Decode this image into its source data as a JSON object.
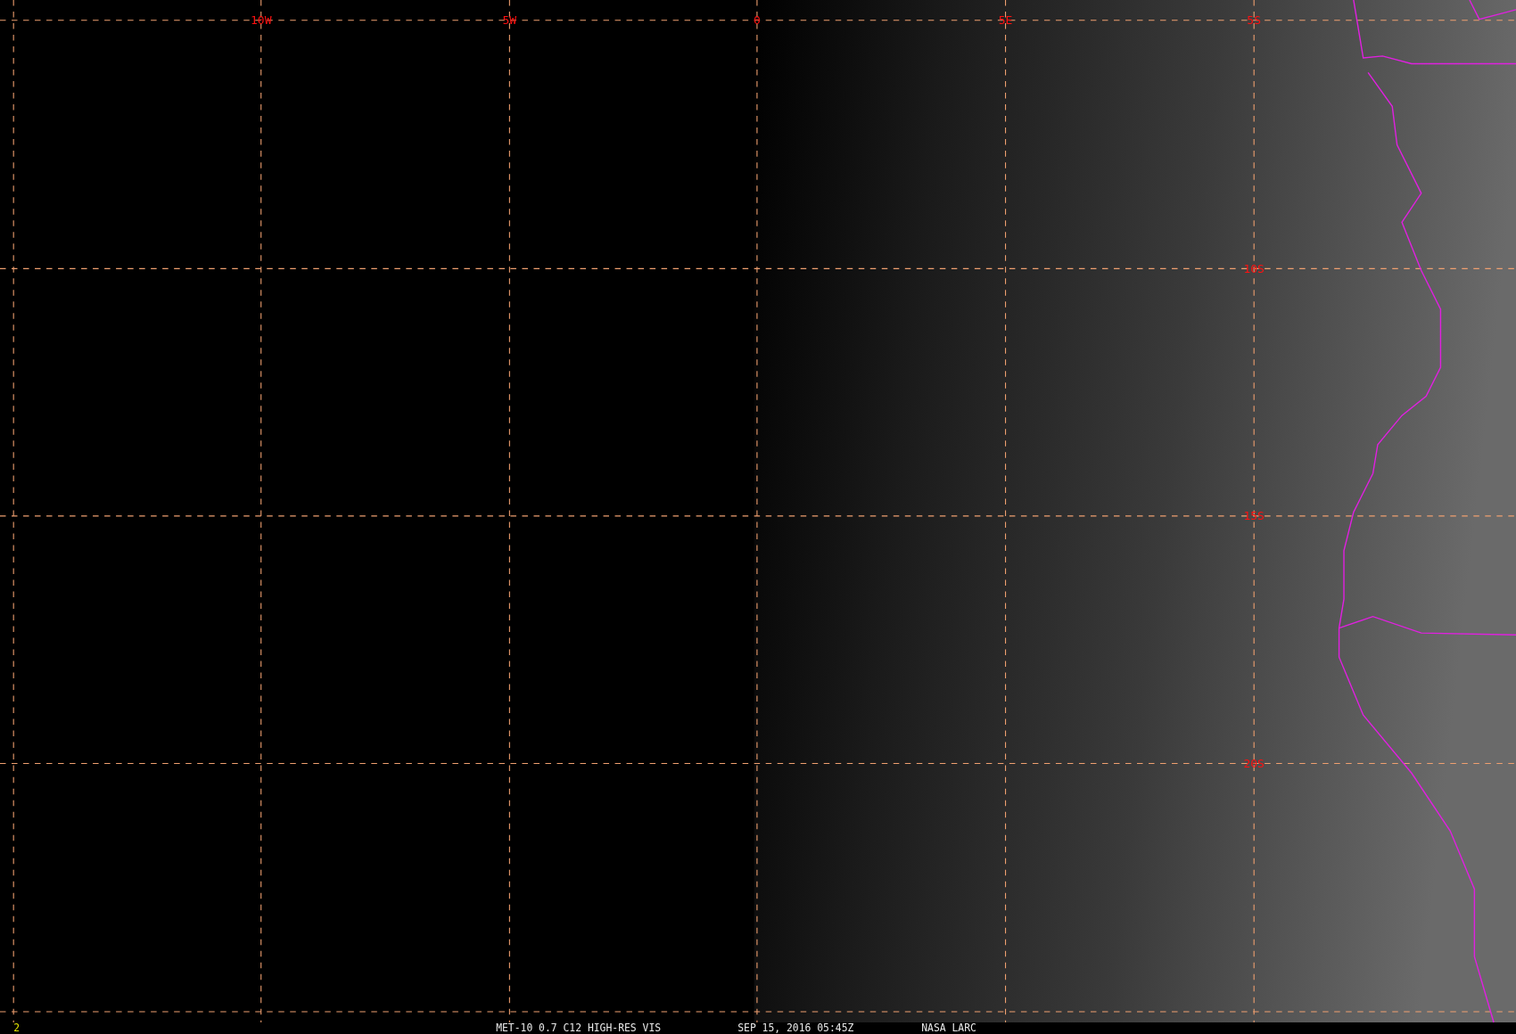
{
  "map": {
    "longitude_labels": [
      "10W",
      "5W",
      "0",
      "5E"
    ],
    "latitude_labels": [
      "5S",
      "10S",
      "15S",
      "20S"
    ]
  },
  "status_bar": {
    "frame_number": "2",
    "product": "MET-10 0.7 C12 HIGH-RES VIS",
    "timestamp": "SEP 15, 2016 05:45Z",
    "source": "NASA LARC"
  }
}
